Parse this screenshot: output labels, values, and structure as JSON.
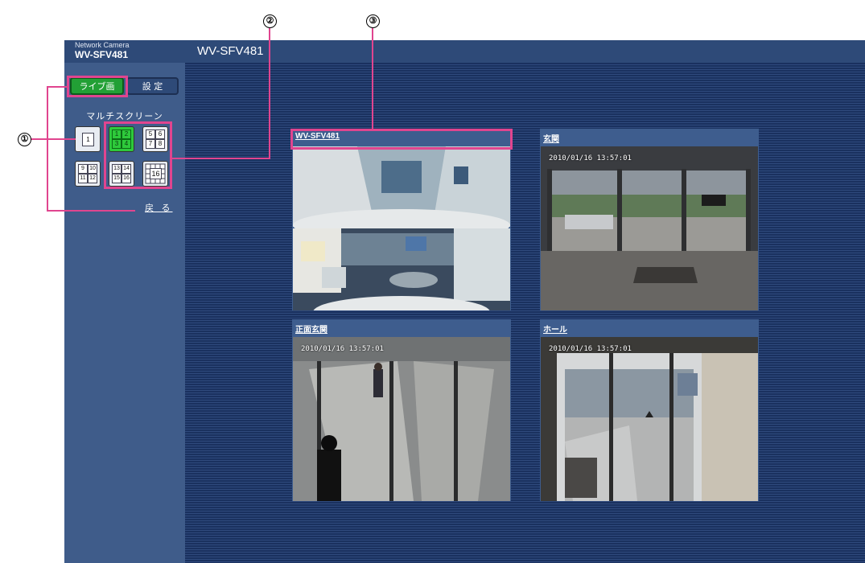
{
  "header": {
    "brand_sub": "Network Camera",
    "brand_model": "WV-SFV481",
    "camera_title": "WV-SFV481"
  },
  "sidebar": {
    "live_label": "ライブ画",
    "setup_label": "設 定",
    "multiscreen_label": "マルチスクリーン",
    "back_label": "戻 る",
    "buttons": [
      {
        "id": "1",
        "cells": [
          "1"
        ]
      },
      {
        "id": "1-4",
        "cells": [
          "1",
          "2",
          "3",
          "4"
        ]
      },
      {
        "id": "5-8",
        "cells": [
          "5",
          "6",
          "7",
          "8"
        ]
      },
      {
        "id": "9-12",
        "cells": [
          "9",
          "10",
          "11",
          "12"
        ]
      },
      {
        "id": "13-16",
        "cells": [
          "13",
          "14",
          "15",
          "16"
        ]
      },
      {
        "id": "16",
        "cells": [
          "16"
        ]
      }
    ]
  },
  "panels": [
    {
      "title": "WV-SFV481",
      "timestamp": ""
    },
    {
      "title": "玄関",
      "timestamp": "2010/01/16 13:57:01"
    },
    {
      "title": "正面玄関",
      "timestamp": "2010/01/16 13:57:01"
    },
    {
      "title": "ホール",
      "timestamp": "2010/01/16 13:57:01"
    }
  ],
  "callouts": {
    "c1": "①",
    "c2": "②",
    "c3": "③"
  },
  "colors": {
    "accent": "#e0458f",
    "live_green": "#22a035",
    "header": "#2e4a78",
    "sidebar": "#3f5c8a"
  }
}
